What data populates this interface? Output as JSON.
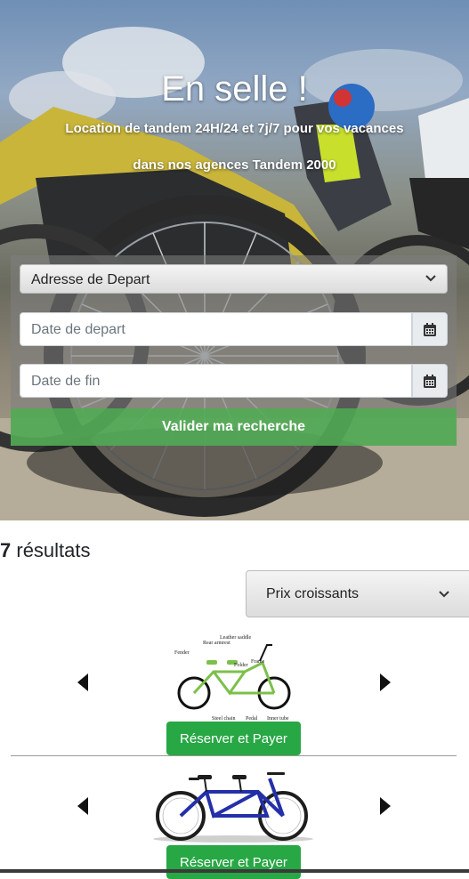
{
  "hero": {
    "title": "En selle !",
    "subtitle_line1": "Location de tandem 24H/24 et 7j/7 pour vos vacances",
    "subtitle_line2": "dans nos agences Tandem 2000"
  },
  "search": {
    "departure_select": "Adresse de Depart",
    "start_date_placeholder": "Date de depart",
    "end_date_placeholder": "Date de fin",
    "submit_label": "Valider ma recherche"
  },
  "results": {
    "count": "7",
    "count_label": " résultats",
    "sort_selected": "Prix croissants",
    "items": [
      {
        "book_label": "Réserver et Payer",
        "diagram_labels": [
          "Leather saddle",
          "Rear armrest",
          "Fender",
          "Folder",
          "Frame",
          "Steel chain",
          "Pedal",
          "Inner tube"
        ]
      },
      {
        "book_label": "Réserver et Payer"
      }
    ]
  },
  "colors": {
    "primary_green": "#28a745",
    "validate_green": "#4cae50",
    "panel_overlay": "#808080"
  },
  "icons": {
    "calendar": "calendar-icon",
    "chevron": "chevron-down-icon",
    "prev": "triangle-left-icon",
    "next": "triangle-right-icon"
  }
}
